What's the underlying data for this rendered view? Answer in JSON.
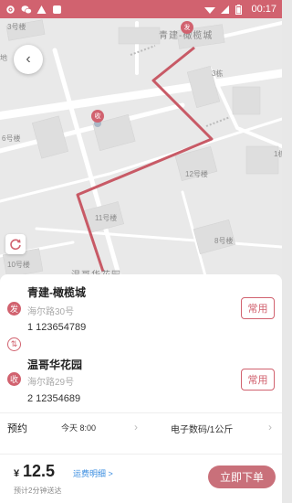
{
  "status_bar": {
    "time": "00:17",
    "icons": [
      "gear-icon",
      "wechat-icon",
      "alert-icon",
      "app-icon",
      "wifi-icon",
      "sim-icon",
      "battery-icon"
    ]
  },
  "map": {
    "labels": [
      "3号楼",
      "青建-橄榄城",
      "3栋",
      "6号楼",
      "12号楼",
      "11号楼",
      "8号楼",
      "10号楼",
      "温哥华花园",
      "1栋",
      "地"
    ],
    "markers": {
      "origin": "发",
      "destination": "收"
    },
    "route_color": "#c85a66"
  },
  "back_button": {
    "icon": "chevron-left-icon",
    "glyph": "‹"
  },
  "origin": {
    "tag": "发",
    "name": "青建-橄榄城",
    "street": "海尔路30号",
    "contact": "1 123654789",
    "fav_label": "常用"
  },
  "swap_glyph": "⇅",
  "destination": {
    "tag": "收",
    "name": "温哥华花园",
    "street": "海尔路29号",
    "contact": "2 12354689",
    "fav_label": "常用"
  },
  "reserve": {
    "label": "预约",
    "time": "今天 8:00",
    "item_type": "电子数码/1公斤"
  },
  "footer": {
    "currency": "¥",
    "price": "12.5",
    "fee_detail": "运费明细 >",
    "eta": "预计2分钟送达",
    "order_label": "立即下单"
  },
  "colors": {
    "accent": "#d1626f",
    "button": "#c9707a",
    "link": "#3a8de0"
  }
}
